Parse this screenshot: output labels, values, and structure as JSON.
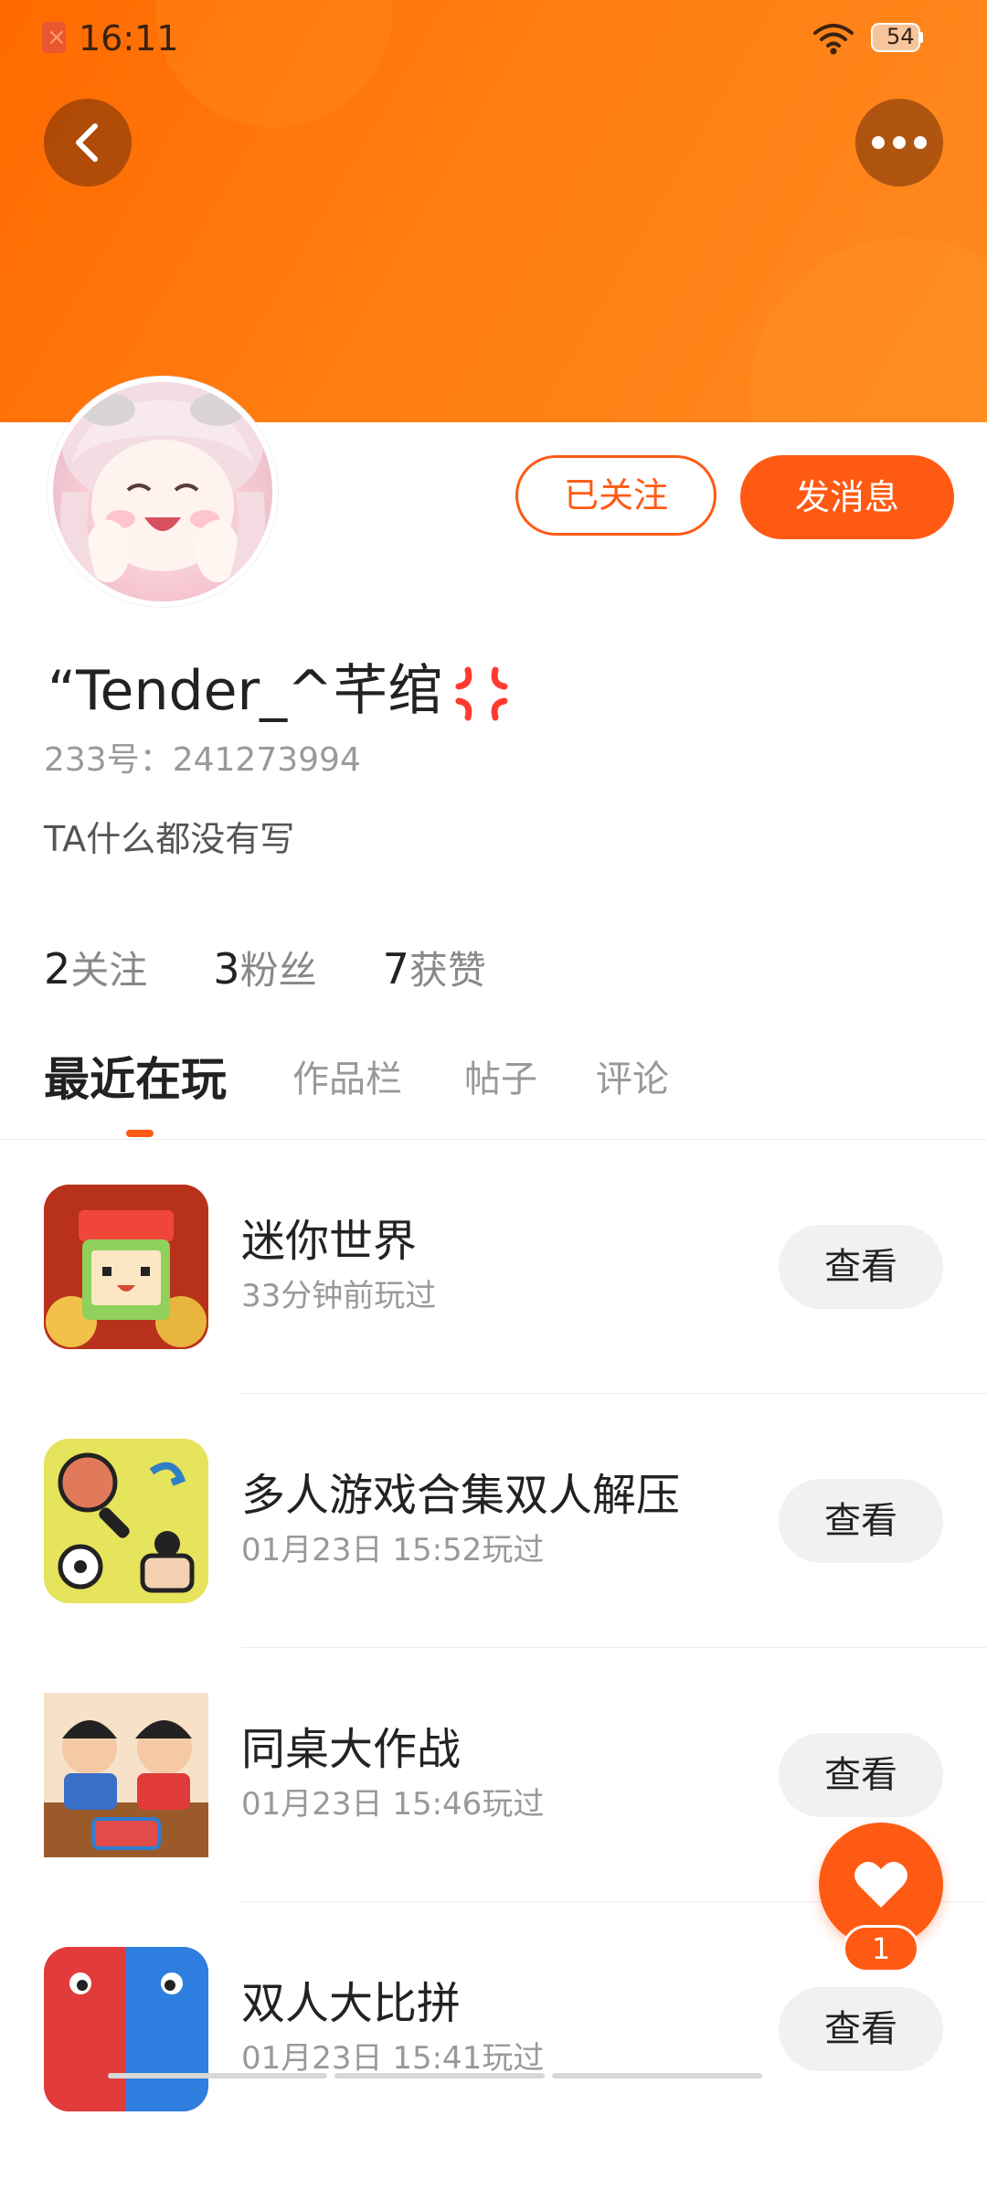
{
  "status_bar": {
    "time": "16:11",
    "battery": "54"
  },
  "header": {
    "back_icon": "chevron-left-icon",
    "more_icon": "more-horizontal-icon"
  },
  "profile": {
    "name": "“Tender_^芊绾",
    "id_text": "233号：241273994",
    "bio": "TA什么都没有写",
    "follow_label": "已关注",
    "message_label": "发消息"
  },
  "stats": [
    {
      "num": "2",
      "label": "关注"
    },
    {
      "num": "3",
      "label": "粉丝"
    },
    {
      "num": "7",
      "label": "获赞"
    }
  ],
  "tabs": [
    {
      "label": "最近在玩",
      "active": true
    },
    {
      "label": "作品栏"
    },
    {
      "label": "帖子"
    },
    {
      "label": "评论"
    }
  ],
  "games": [
    {
      "title": "迷你世界",
      "time": "33分钟前玩过",
      "button": "查看"
    },
    {
      "title": "多人游戏合集双人解压",
      "time": "01月23日 15:52玩过",
      "button": "查看"
    },
    {
      "title": "同桌大作战",
      "time": "01月23日 15:46玩过",
      "button": "查看"
    },
    {
      "title": "双人大比拼",
      "time": "01月23日 15:41玩过",
      "button": "查看"
    }
  ],
  "fab": {
    "icon": "heart-icon",
    "badge": "1"
  },
  "colors": {
    "accent": "#ff5a14",
    "banner": "#ff7a10"
  }
}
